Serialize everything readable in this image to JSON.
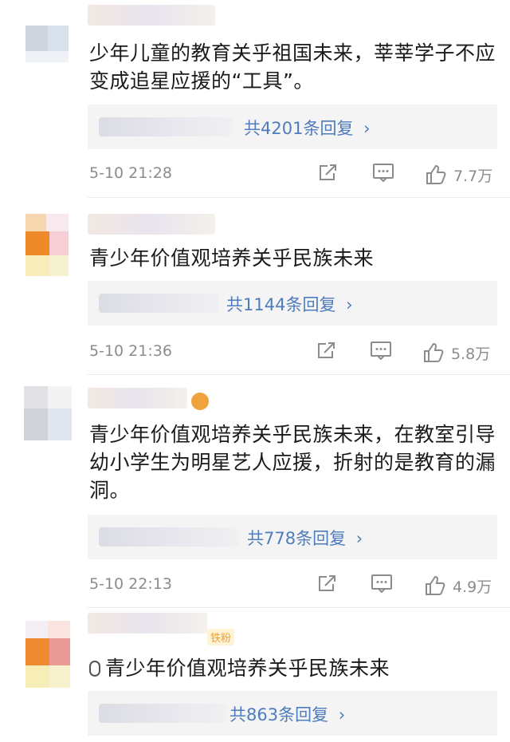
{
  "comments": [
    {
      "text": "少年儿童的教育关乎祖国未来，莘莘学子不应变成追星应援的“工具”。",
      "replies": "共4201条回复",
      "time": "5-10 21:28",
      "likes": "7.7万"
    },
    {
      "text": "青少年价值观培养关乎民族未来",
      "replies": "共1144条回复",
      "time": "5-10 21:36",
      "likes": "5.8万"
    },
    {
      "text": "青少年价值观培养关乎民族未来，在教室引导幼小学生为明星艺人应援，折射的是教育的漏洞。",
      "replies": "共778条回复",
      "time": "5-10 22:13",
      "likes": "4.9万"
    },
    {
      "text": "青少年价值观培养关乎民族未来",
      "replies": "共863条回复",
      "badge": "铁粉"
    }
  ],
  "icons": {
    "repost": "repost-icon",
    "comment": "comment-icon",
    "like": "thumbs-up-icon",
    "chevron": "chevron-right-icon",
    "mic": "microphone-icon"
  },
  "colors": {
    "link": "#4f7cbc",
    "meta": "#8c8c8c",
    "reply_bg": "#f4f4f4"
  }
}
